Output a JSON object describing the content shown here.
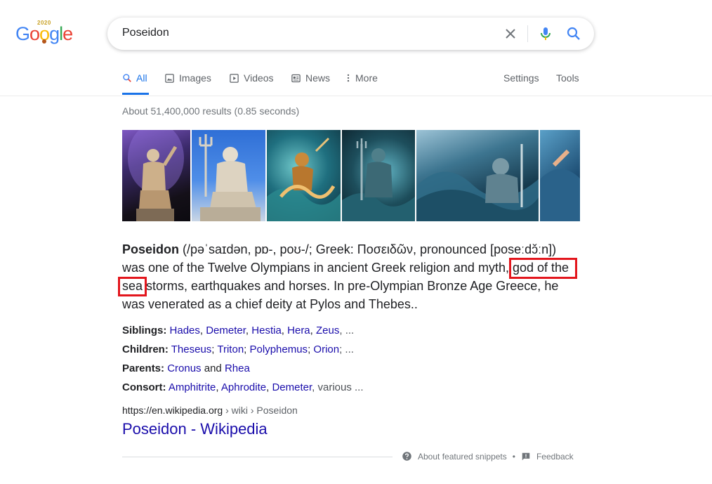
{
  "logo": {
    "year": "2020",
    "letters": [
      "G",
      "o",
      "o",
      "g",
      "l",
      "e"
    ],
    "colors": [
      "#4285f4",
      "#ea4335",
      "#fbbc05",
      "#4285f4",
      "#34a853",
      "#ea4335"
    ]
  },
  "search": {
    "query": "Poseidon"
  },
  "tabs": [
    {
      "label": "All",
      "icon": "search-icon",
      "active": true
    },
    {
      "label": "Images",
      "icon": "image-icon"
    },
    {
      "label": "Videos",
      "icon": "video-icon"
    },
    {
      "label": "News",
      "icon": "news-icon"
    },
    {
      "label": "More",
      "icon": "more-vert-icon"
    }
  ],
  "tabs_right": {
    "settings": "Settings",
    "tools": "Tools"
  },
  "stats": "About 51,400,000 results (0.85 seconds)",
  "snippet": {
    "bold": "Poseidon",
    "line1_rest": " (/pəˈsaɪdən, pɒ-, poʊ-/; Greek: Ποσειδῶν, pronounced [poseːdɔ̌ːn])",
    "line2": "was one of the Twelve Olympians in ancient Greek religion and myth, ",
    "highlight1": "god of the",
    "highlight2": "sea",
    "line3_rest": " storms, earthquakes and horses. In pre-Olympian Bronze Age Greece, he",
    "line4": "was venerated as a chief deity at Pylos and Thebes.."
  },
  "facts": [
    {
      "label": "Siblings:",
      "links": [
        "Hades",
        "Demeter",
        "Hestia",
        "Hera",
        "Zeus"
      ],
      "sep": ", ",
      "tail": ", ..."
    },
    {
      "label": "Children:",
      "links": [
        "Theseus",
        "Triton",
        "Polyphemus",
        "Orion"
      ],
      "sep": "; ",
      "tail": "; ..."
    },
    {
      "label": "Parents:",
      "links": [
        "Cronus",
        "Rhea"
      ],
      "sep": " and ",
      "tail": ""
    },
    {
      "label": "Consort:",
      "links": [
        "Amphitrite",
        "Aphrodite",
        "Demeter"
      ],
      "sep": ", ",
      "tail": ", various ..."
    }
  ],
  "result": {
    "domain": "https://en.wikipedia.org",
    "breadcrumb": " › wiki › Poseidon",
    "title": "Poseidon - Wikipedia"
  },
  "footer": {
    "about": "About featured snippets",
    "dot": "•",
    "feedback": "Feedback"
  },
  "colors": {
    "link": "#1a0dab",
    "accent": "#1a73e8",
    "highlight_box": "#e3161d"
  }
}
